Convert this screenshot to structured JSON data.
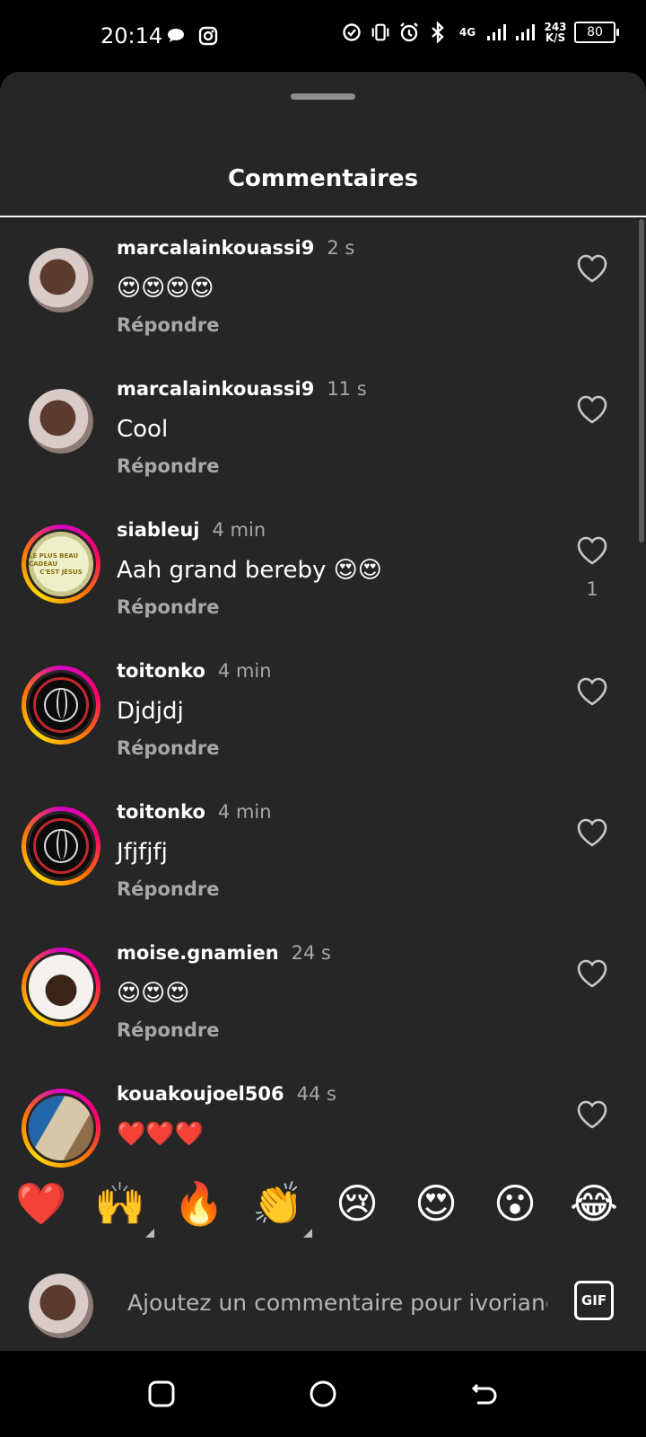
{
  "status_bar": {
    "time": "20:14",
    "network_type": "4G",
    "network_speed_value": "243",
    "network_speed_unit": "K/S",
    "battery": "80"
  },
  "sheet": {
    "title": "Commentaires"
  },
  "comments": [
    {
      "username": "marcalainkouassi9",
      "time": "2 s",
      "text": "😍😍😍😍",
      "reply": "Répondre",
      "likes": ""
    },
    {
      "username": "marcalainkouassi9",
      "time": "11 s",
      "text": "Cool",
      "reply": "Répondre",
      "likes": ""
    },
    {
      "username": "siableuj",
      "time": "4 min",
      "text": "Aah grand bereby 😍😍",
      "reply": "Répondre",
      "likes": "1"
    },
    {
      "username": "toitonko",
      "time": "4 min",
      "text": "Djdjdj",
      "reply": "Répondre",
      "likes": ""
    },
    {
      "username": "toitonko",
      "time": "4 min",
      "text": "Jfjfjfj",
      "reply": "Répondre",
      "likes": ""
    },
    {
      "username": "moise.gnamien",
      "time": "24 s",
      "text": "😍😍😍",
      "reply": "Répondre",
      "likes": ""
    },
    {
      "username": "kouakoujoel506",
      "time": "44 s",
      "text": "❤️❤️❤️",
      "reply": "",
      "likes": ""
    }
  ],
  "avatar_texts": {
    "poster_line1": "LE PLUS BEAU CADEAU",
    "poster_line2": "C'EST JÉSUS"
  },
  "emoji_bar": [
    "❤️",
    "🙌",
    "🔥",
    "👏",
    "😢",
    "😍",
    "😮",
    "😂"
  ],
  "composer": {
    "placeholder": "Ajoutez un commentaire pour ivoriang",
    "gif_label": "GIF"
  },
  "icons": {
    "heart": "heart-outline-icon",
    "nav": [
      "recent-apps-icon",
      "home-icon",
      "back-icon"
    ]
  }
}
